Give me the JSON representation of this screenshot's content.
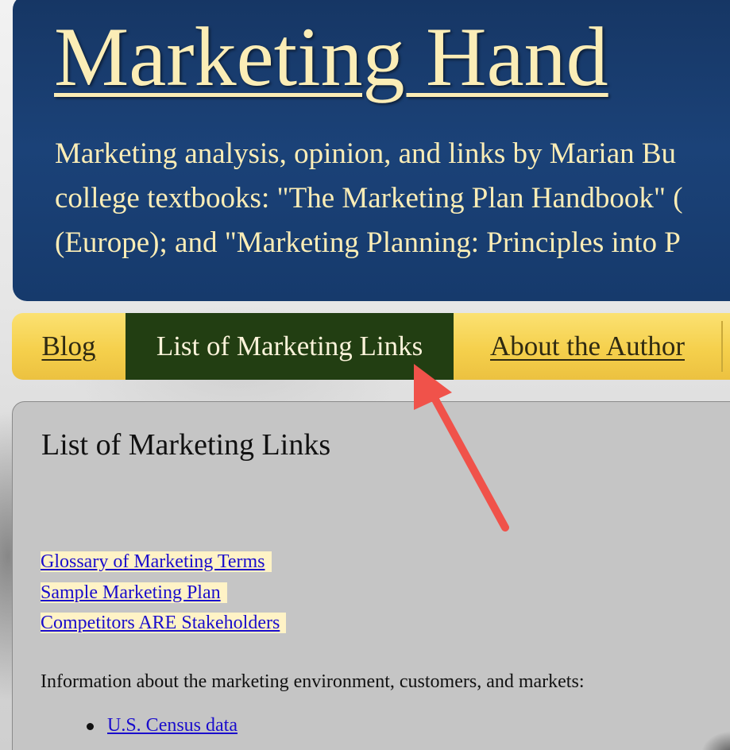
{
  "header": {
    "site_title": "Marketing Hand",
    "description_lines": [
      "Marketing analysis, opinion, and links by Marian Bu",
      "college textbooks: \"The Marketing Plan Handbook\" (",
      "(Europe); and \"Marketing Planning: Principles into P"
    ]
  },
  "nav": {
    "tabs": [
      {
        "label": "Blog",
        "active": false
      },
      {
        "label": "List of Marketing Links",
        "active": true
      },
      {
        "label": "About the Author",
        "active": false
      }
    ]
  },
  "main": {
    "title": "List of Marketing Links",
    "quick_links": [
      "Glossary of Marketing Terms",
      "Sample Marketing Plan",
      "Competitors ARE Stakeholders"
    ],
    "intro_text": "Information about the marketing environment, customers, and markets:",
    "bullet_links": [
      "U.S. Census data"
    ]
  },
  "annotation": {
    "arrow_color": "#f0524a",
    "points_to": "List of Marketing Links tab"
  },
  "colors": {
    "header_bg": "#163664",
    "header_text": "#fbedb6",
    "nav_bg": "#f5d04c",
    "active_tab_bg": "#223e12",
    "content_bg": "#c5c5c5",
    "link": "#1a0dcc",
    "link_highlight": "#fff3c6"
  }
}
